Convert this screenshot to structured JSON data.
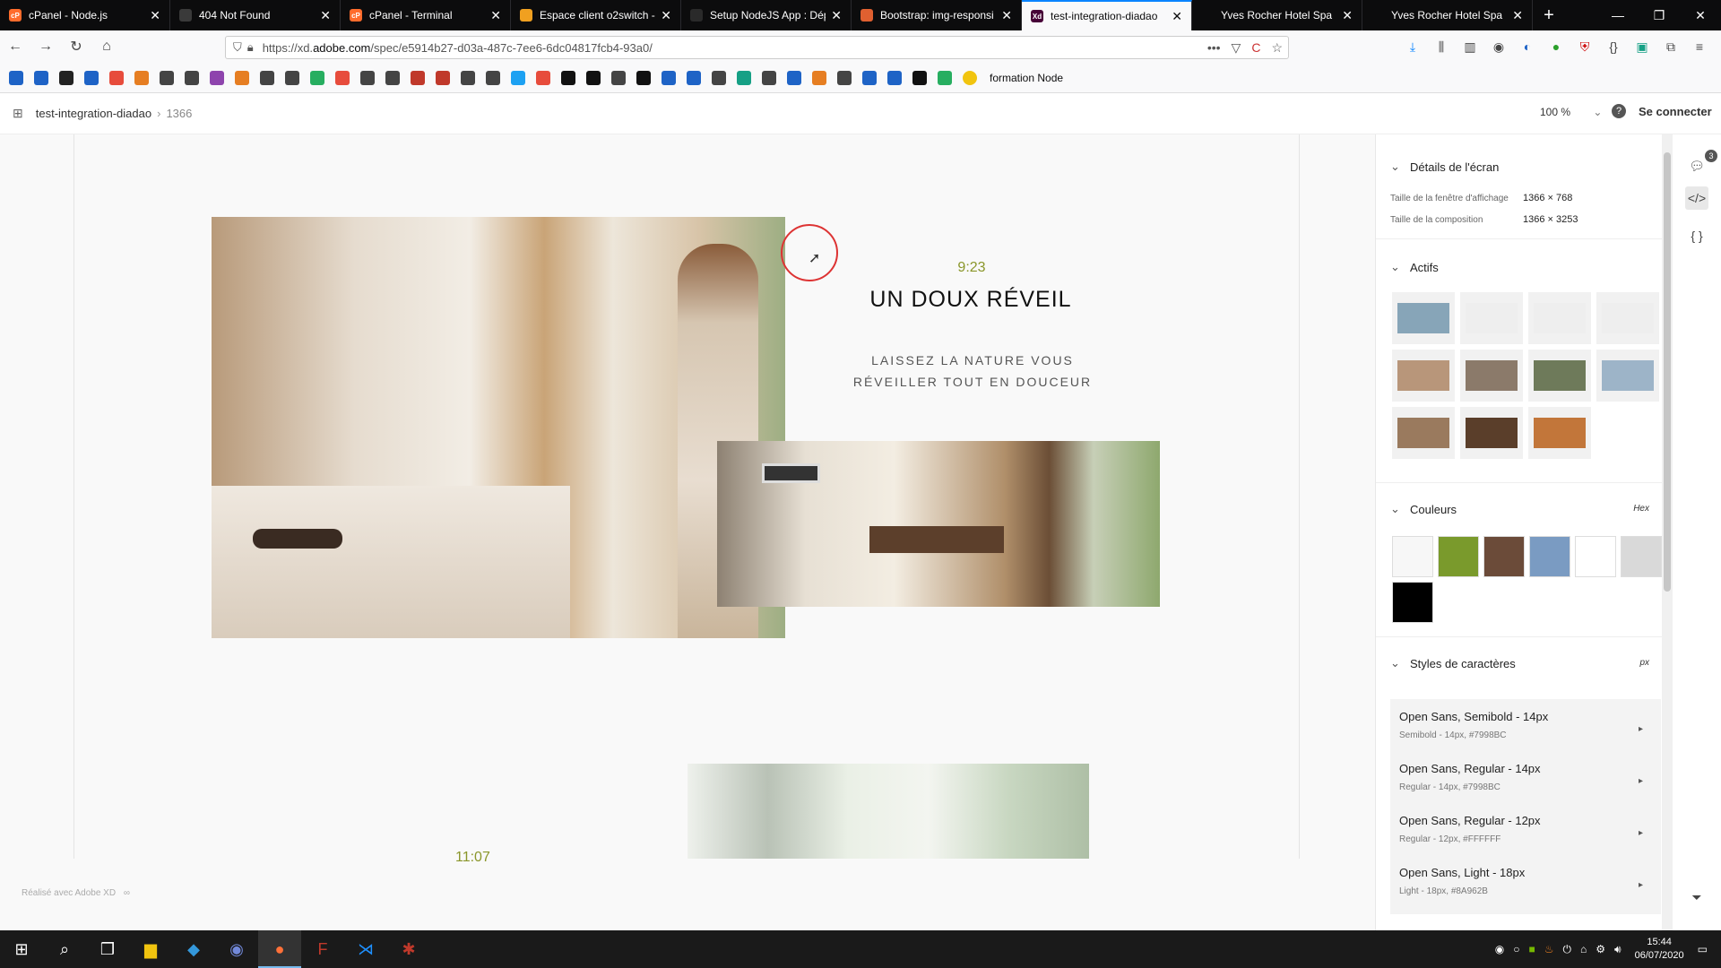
{
  "browser": {
    "tabs": [
      {
        "label": "cPanel - Node.js",
        "favicon_color": "#ff6c2c",
        "favicon_text": "cP"
      },
      {
        "label": "404 Not Found",
        "favicon_color": "#3a3a3a",
        "favicon_text": ""
      },
      {
        "label": "cPanel - Terminal",
        "favicon_color": "#ff6c2c",
        "favicon_text": "cP"
      },
      {
        "label": "Espace client o2switch -",
        "favicon_color": "#f0a020",
        "favicon_text": ""
      },
      {
        "label": "Setup NodeJS App : Dép",
        "favicon_color": "#2a2a2a",
        "favicon_text": ""
      },
      {
        "label": "Bootstrap: img-responsi",
        "favicon_color": "#e06030",
        "favicon_text": ""
      },
      {
        "label": "test-integration-diadao",
        "favicon_color": "#470137",
        "favicon_text": "Xd"
      },
      {
        "label": "Yves Rocher Hotel Spa",
        "favicon_color": "#0c0c0d",
        "favicon_text": ""
      },
      {
        "label": "Yves Rocher Hotel Spa",
        "favicon_color": "#0c0c0d",
        "favicon_text": ""
      }
    ],
    "active_tab": 6,
    "url_prefix": "https://xd.",
    "url_domain": "adobe.com",
    "url_rest": "/spec/e5914b27-d03a-487c-7ee6-6dc04817fcb4-93a0/",
    "bookmark_label": "formation Node",
    "bookmark_colors": [
      "#1e63c6",
      "#1e63c6",
      "#222",
      "#1e63c6",
      "#e74c3c",
      "#e67e22",
      "#444",
      "#444",
      "#8e44ad",
      "#e67e22",
      "#444",
      "#444",
      "#27ae60",
      "#e74c3c",
      "#444",
      "#444",
      "#c0392b",
      "#c0392b",
      "#444",
      "#444",
      "#1da1f2",
      "#e74c3c",
      "#111",
      "#111",
      "#444",
      "#111",
      "#1e63c6",
      "#1e63c6",
      "#444",
      "#16a085",
      "#444",
      "#1e63c6",
      "#e67e22",
      "#444",
      "#1e63c6",
      "#1e63c6",
      "#111",
      "#27ae60"
    ]
  },
  "xd": {
    "project": "test-integration-diadao",
    "artboard": "1366",
    "zoom": "100 %",
    "signin": "Se connecter"
  },
  "canvas": {
    "time1": "9:23",
    "heading": "UN DOUX RÉVEIL",
    "sub_line1": "LAISSEZ LA NATURE VOUS",
    "sub_line2": "RÉVEILLER TOUT EN DOUCEUR",
    "time2": "11:07",
    "made_with": "Réalisé avec Adobe XD"
  },
  "panel": {
    "details_title": "Détails de l'écran",
    "viewport_label": "Taille de la fenêtre d'affichage",
    "viewport_value": "1366 × 768",
    "comp_label": "Taille de la composition",
    "comp_value": "1366 × 3253",
    "assets_title": "Actifs",
    "colors_title": "Couleurs",
    "colors_unit": "Hex",
    "colors": [
      "#f7f7f7",
      "#7a9a2c",
      "#6b4b39",
      "#7a9bc2",
      "#ffffff",
      "#d9d9d9",
      "#000000"
    ],
    "asset_thumbs": [
      "#87a5b8",
      "#eeeeee",
      "#eeeeee",
      "#eeeeee",
      "#b8967a",
      "#8b7a6a",
      "#6e7a5a",
      "#9db4c8",
      "#9a7a5e",
      "#5a3e2a",
      "#c2763a"
    ],
    "styles_title": "Styles de caractères",
    "styles_unit": "px",
    "styles": [
      {
        "name": "Open Sans, Semibold - 14px",
        "detail": "Semibold - 14px, #7998BC"
      },
      {
        "name": "Open Sans, Regular - 14px",
        "detail": "Regular - 14px, #7998BC"
      },
      {
        "name": "Open Sans, Regular - 12px",
        "detail": "Regular - 12px, #FFFFFF"
      },
      {
        "name": "Open Sans, Light - 18px",
        "detail": "Light - 18px, #8A962B"
      }
    ],
    "comments_count": "3"
  },
  "taskbar": {
    "time": "15:44",
    "date": "06/07/2020"
  }
}
